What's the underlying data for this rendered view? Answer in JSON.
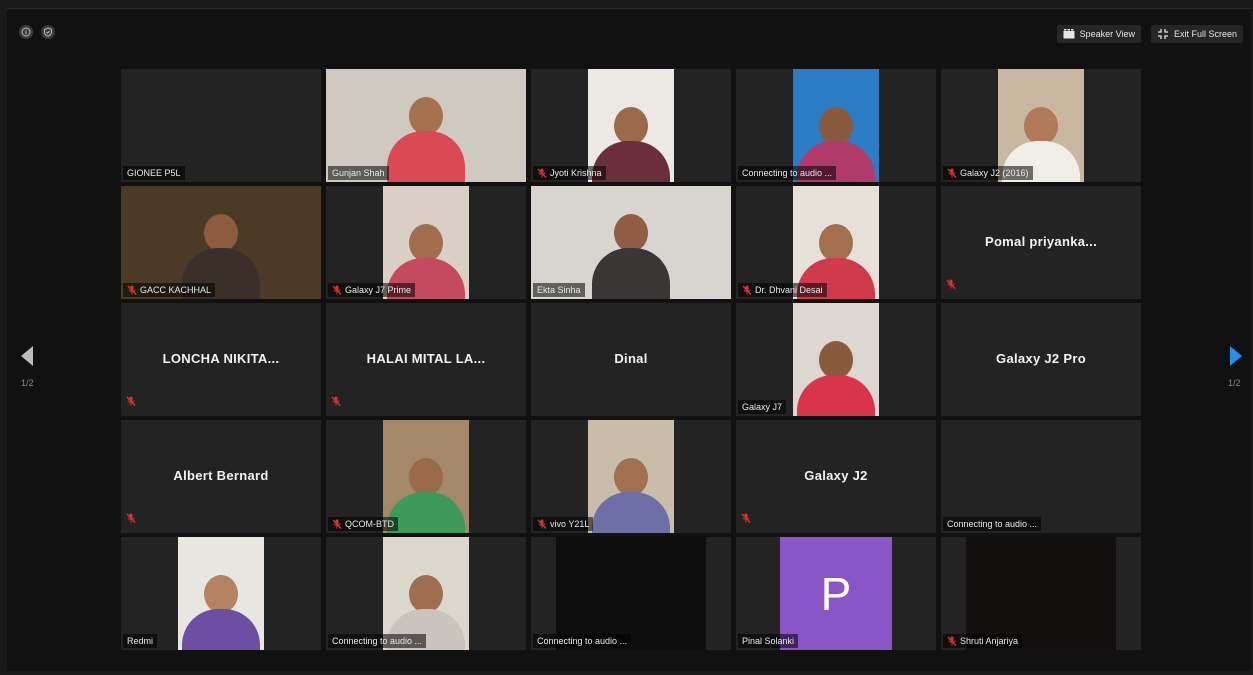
{
  "window": {
    "speaker_view_label": "Speaker View",
    "exit_fullscreen_label": "Exit Full Screen",
    "page_left": "1/2",
    "page_right": "1/2"
  },
  "tiles": [
    {
      "name": "GIONEE P5L",
      "style": "video-off",
      "muted": false,
      "bg": "#222222"
    },
    {
      "name": "Gunjan Shah",
      "style": "video-full",
      "muted": false,
      "bg": "#cfc9c0",
      "skin": "#a5714f",
      "shirt": "#d94a55"
    },
    {
      "name": "Jyoti Krishna",
      "style": "video-center",
      "muted": true,
      "bg": "#ece9e4",
      "skin": "#9b6a4c",
      "shirt": "#6a2f3b"
    },
    {
      "name": "Connecting to audio ...",
      "style": "video-center",
      "muted": false,
      "bg": "#2a7dc4",
      "skin": "#8a5a3e",
      "shirt": "#b23a6a"
    },
    {
      "name": "Galaxy J2 (2016)",
      "style": "video-center",
      "muted": true,
      "bg": "#c9b7a2",
      "skin": "#b07a58",
      "shirt": "#f0eee6"
    },
    {
      "name": "GACC KACHHAL",
      "style": "video-full",
      "muted": true,
      "bg": "#4a3a26",
      "skin": "#8d5b3d",
      "shirt": "#3b2f2a"
    },
    {
      "name": "Galaxy J7 Prime",
      "style": "video-center",
      "muted": true,
      "bg": "#d9cfc4",
      "skin": "#a06d4d",
      "shirt": "#c44a5f"
    },
    {
      "name": "Ekta Sinha",
      "style": "video-full",
      "muted": false,
      "active": true,
      "bg": "#d8d4cf",
      "skin": "#8f5e45",
      "shirt": "#3a3635"
    },
    {
      "name": "Dr. Dhvani Desai",
      "style": "video-center",
      "muted": true,
      "bg": "#e6e0d8",
      "skin": "#a46f4f",
      "shirt": "#cf3b4a"
    },
    {
      "name": "Pomal priyanka...",
      "style": "name-only",
      "muted": true
    },
    {
      "name": "LONCHA NIKITA...",
      "style": "name-only",
      "muted": true
    },
    {
      "name": "HALAI MITAL LA...",
      "style": "name-only",
      "muted": true
    },
    {
      "name": "Dinal",
      "style": "name-only",
      "muted": false
    },
    {
      "name": "Galaxy J7",
      "style": "video-center",
      "muted": false,
      "bg": "#dcd7d0",
      "skin": "#8a5a3f",
      "shirt": "#d8354a"
    },
    {
      "name": "Galaxy J2 Pro",
      "style": "name-only",
      "muted": false
    },
    {
      "name": "Albert Bernard",
      "style": "name-only",
      "muted": true
    },
    {
      "name": "QCOM-BTD",
      "style": "video-center",
      "muted": true,
      "bg": "#a5886a",
      "skin": "#9a6a4b",
      "shirt": "#3e9a5a"
    },
    {
      "name": "vivo Y21L",
      "style": "video-center",
      "muted": true,
      "bg": "#c9bca9",
      "skin": "#a07050",
      "shirt": "#6f6fa8"
    },
    {
      "name": "Galaxy J2",
      "style": "name-only",
      "muted": true
    },
    {
      "name": "Connecting to audio ...",
      "style": "video-off",
      "muted": false,
      "bg": "#222222"
    },
    {
      "name": "Redmi",
      "style": "video-center",
      "muted": false,
      "bg": "#e9e6e2",
      "skin": "#b38260",
      "shirt": "#6c4fa3"
    },
    {
      "name": "Connecting to audio ...",
      "style": "video-center",
      "muted": false,
      "bg": "#dcd6cd",
      "skin": "#9f6e50",
      "shirt": "#c9c4be"
    },
    {
      "name": "Connecting to audio ...",
      "style": "video-dark",
      "muted": false,
      "bg": "#0e0e0e"
    },
    {
      "name": "Pinal Solanki",
      "style": "avatar",
      "avatar": "P",
      "muted": false
    },
    {
      "name": "Shruti Anjariya",
      "style": "video-dark",
      "muted": true,
      "bg": "#140f0f"
    }
  ],
  "colors": {
    "active_border": "#9bd13a",
    "mute_red": "#d9342b",
    "arrow_left": "#bcbcbc",
    "arrow_right": "#2d8ce3",
    "avatar_purple": "#8a55c7"
  }
}
